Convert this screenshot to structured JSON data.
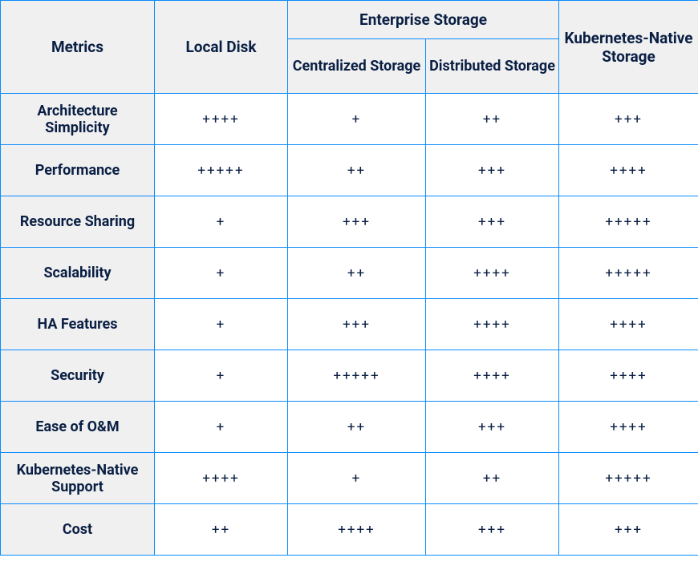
{
  "chart_data": {
    "type": "table",
    "title": "",
    "header": {
      "metrics": "Metrics",
      "local_disk": "Local Disk",
      "enterprise_group": "Enterprise Storage",
      "centralized": "Centralized Storage",
      "distributed": "Distributed Storage",
      "k8s_native": "Kubernetes-Native Storage"
    },
    "rows": [
      {
        "metric": "Architecture Simplicity",
        "local_disk": "++++",
        "centralized": "+",
        "distributed": "++",
        "k8s_native": "+++"
      },
      {
        "metric": "Performance",
        "local_disk": "+++++",
        "centralized": "++",
        "distributed": "+++",
        "k8s_native": "++++"
      },
      {
        "metric": "Resource Sharing",
        "local_disk": "+",
        "centralized": "+++",
        "distributed": "+++",
        "k8s_native": "+++++"
      },
      {
        "metric": "Scalability",
        "local_disk": "+",
        "centralized": "++",
        "distributed": "++++",
        "k8s_native": "+++++"
      },
      {
        "metric": "HA Features",
        "local_disk": "+",
        "centralized": "+++",
        "distributed": "++++",
        "k8s_native": "++++"
      },
      {
        "metric": "Security",
        "local_disk": "+",
        "centralized": "+++++",
        "distributed": "++++",
        "k8s_native": "++++"
      },
      {
        "metric": "Ease of O&M",
        "local_disk": "+",
        "centralized": "++",
        "distributed": "+++",
        "k8s_native": "++++"
      },
      {
        "metric": "Kubernetes-Native Support",
        "local_disk": "++++",
        "centralized": "+",
        "distributed": "++",
        "k8s_native": "+++++"
      },
      {
        "metric": "Cost",
        "local_disk": "++",
        "centralized": "++++",
        "distributed": "+++",
        "k8s_native": "+++"
      }
    ]
  }
}
